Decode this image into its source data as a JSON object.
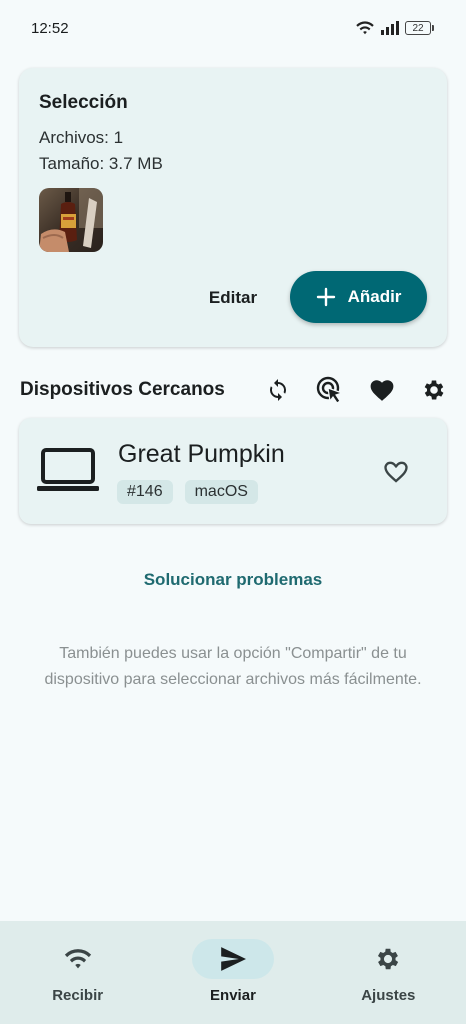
{
  "status_bar": {
    "time": "12:52",
    "battery": "22"
  },
  "selection": {
    "title": "Selección",
    "files": "Archivos: 1",
    "size": "Tamaño: 3.7 MB",
    "edit_label": "Editar",
    "add_label": "Añadir"
  },
  "devices": {
    "title": "Dispositivos Cercanos",
    "items": [
      {
        "name": "Great Pumpkin",
        "tags": [
          "#146",
          "macOS"
        ]
      }
    ]
  },
  "troubleshoot_label": "Solucionar problemas",
  "hint": "También puedes usar la opción \"Compartir\" de tu dispositivo para seleccionar archivos más fácilmente.",
  "nav": {
    "items": [
      {
        "label": "Recibir",
        "icon": "wifi-icon"
      },
      {
        "label": "Enviar",
        "icon": "send-icon",
        "active": true
      },
      {
        "label": "Ajustes",
        "icon": "gear-icon"
      }
    ]
  },
  "colors": {
    "accent": "#006874",
    "card_bg": "#e8f3f3",
    "nav_bg": "#dfeceb",
    "link": "#1f6a70"
  }
}
